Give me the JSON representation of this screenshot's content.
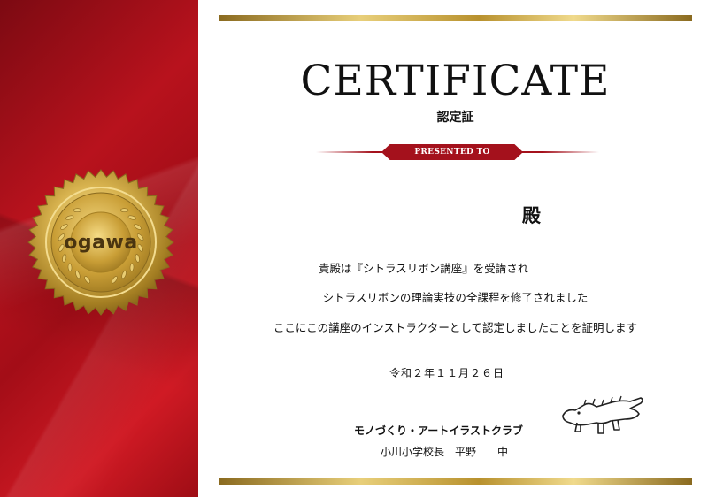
{
  "certificate": {
    "title": "CERTIFICATE",
    "subtitle": "認定証",
    "ribbon_text": "PRESENTED TO",
    "honorific": "殿",
    "body_lines": [
      "貴殿は『シトラスリボン講座』を受講され",
      "シトラスリボンの理論実技の全課程を修了されました",
      "ここにこの講座のインストラクターとして認定しましたことを証明します"
    ],
    "date": "令和２年１１月２６日",
    "organization": "モノづくり・アートイラストクラブ",
    "signer": "小川小学校長　平野　　中"
  },
  "seal": {
    "text": "ogawa",
    "icon": "gold-seal-icon"
  },
  "signature_drawing": {
    "icon": "crocodile-drawing-icon"
  },
  "colors": {
    "panel_red": "#b8121d",
    "ribbon_red": "#a4111c",
    "gold": "#d4b45a"
  }
}
